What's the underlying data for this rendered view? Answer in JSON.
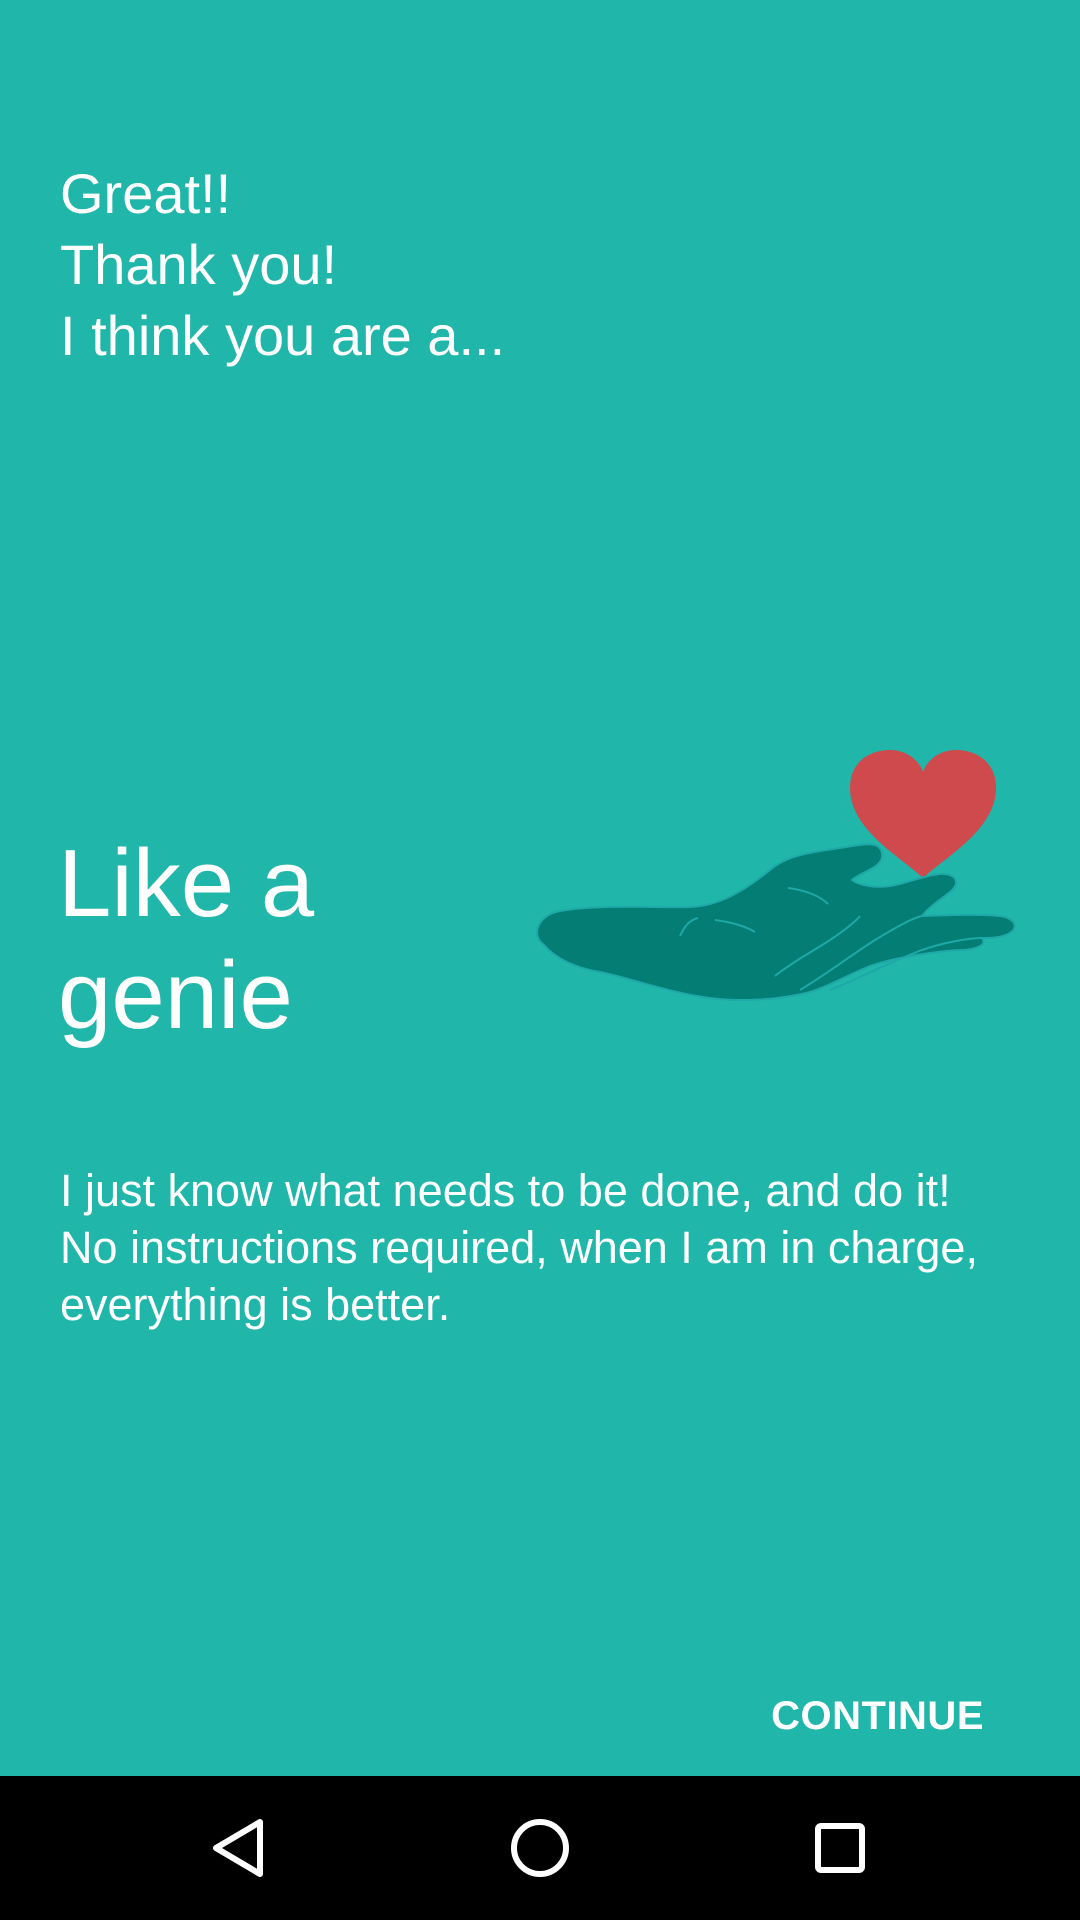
{
  "intro": {
    "line1": "Great!!",
    "line2": "Thank you!",
    "line3": "I think you are a..."
  },
  "result": {
    "title_line1": "Like a",
    "title_line2": "genie",
    "description": "I just know what needs to be done, and do it! No instructions required, when I am in charge, everything is better.",
    "illustration": "hand-offering-heart-icon"
  },
  "actions": {
    "continue_label": "CONTINUE"
  },
  "navbar": {
    "back_icon": "back-triangle-icon",
    "home_icon": "home-circle-icon",
    "recents_icon": "recents-square-icon"
  },
  "colors": {
    "background": "#20b6aa",
    "hand": "#047d74",
    "hand_outline": "#1fa8a8",
    "heart": "#cf4a4c",
    "text": "#ffffff",
    "navbar": "#000000"
  }
}
